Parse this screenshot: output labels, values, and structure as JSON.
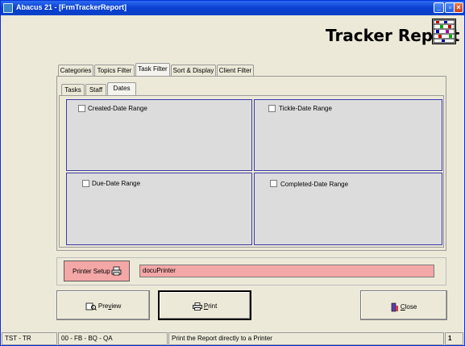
{
  "window": {
    "title": "Abacus 21 - [FrmTrackerReport]",
    "controls": {
      "minimize": "_",
      "restore": "▫",
      "close": "×"
    }
  },
  "header": {
    "title": "Tracker Report",
    "logo_icon": "abacus-icon"
  },
  "outer_tabs": [
    "Categories",
    "Topics Filter",
    "Task Filter",
    "Sort & Display",
    "Client Filter"
  ],
  "outer_active": "Task Filter",
  "inner_tabs": [
    "Tasks",
    "Staff",
    "Dates"
  ],
  "inner_active": "Dates",
  "date_ranges": {
    "created": "Created-Date Range",
    "tickle": "Tickle-Date Range",
    "due": "Due-Date Range",
    "completed": "Completed-Date Range"
  },
  "printer": {
    "setup_label": "Printer Setup",
    "name": "docuPrinter"
  },
  "buttons": {
    "preview_pre": "Pre",
    "preview_underline": "v",
    "preview_post": "iew",
    "print_underline": "P",
    "print_post": "rint",
    "close_underline": "C",
    "close_post": "lose"
  },
  "status": {
    "user": "TST - TR",
    "codes": "00 - FB - BQ - QA",
    "message": "Print the Report directly to a Printer",
    "page": "1"
  },
  "colors": {
    "title_bar": "#0a3fd1",
    "printer_highlight": "#f4a7a7",
    "panel_border": "#3a3aa8"
  }
}
